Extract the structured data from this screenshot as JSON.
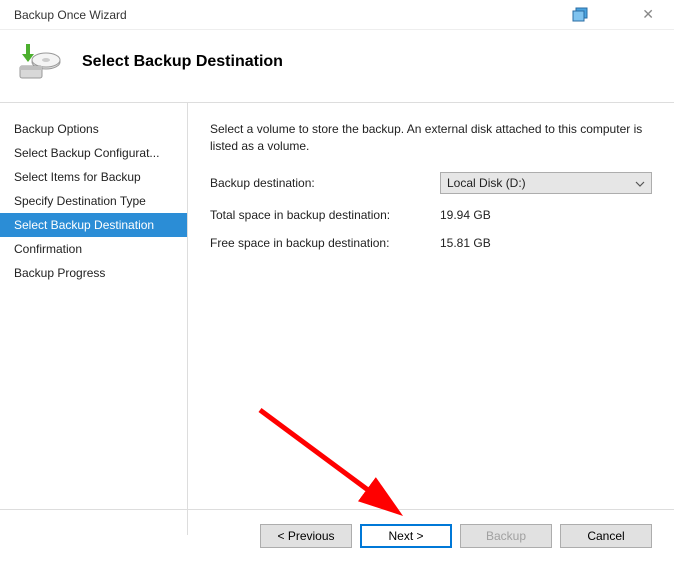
{
  "title": "Backup Once Wizard",
  "header": {
    "title": "Select Backup Destination"
  },
  "sidebar": {
    "items": [
      {
        "label": "Backup Options"
      },
      {
        "label": "Select Backup Configurat..."
      },
      {
        "label": "Select Items for Backup"
      },
      {
        "label": "Specify Destination Type"
      },
      {
        "label": "Select Backup Destination"
      },
      {
        "label": "Confirmation"
      },
      {
        "label": "Backup Progress"
      }
    ],
    "selected_index": 4
  },
  "main": {
    "instruction": "Select a volume to store the backup. An external disk attached to this computer is listed as a volume.",
    "dest_label": "Backup destination:",
    "dest_value": "Local Disk (D:)",
    "total_label": "Total space in backup destination:",
    "total_value": "19.94 GB",
    "free_label": "Free space in backup destination:",
    "free_value": "15.81 GB"
  },
  "footer": {
    "previous": "< Previous",
    "next": "Next >",
    "backup": "Backup",
    "cancel": "Cancel"
  }
}
